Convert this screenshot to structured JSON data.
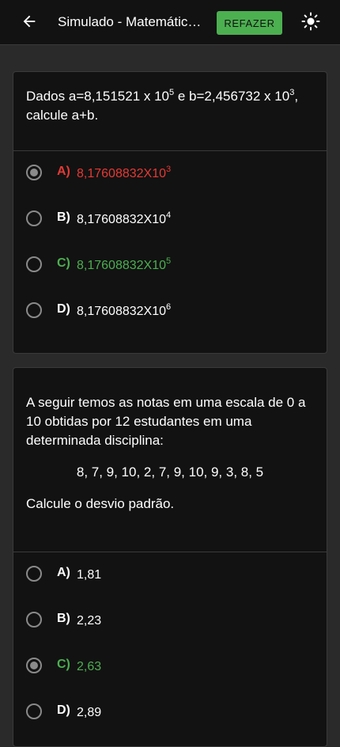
{
  "header": {
    "title": "Simulado - Matemática - Estatística",
    "redo_label": "REFAZER",
    "back_icon": "arrow-left-icon",
    "theme_icon": "sun-icon"
  },
  "colors": {
    "wrong": "#e53935",
    "correct": "#4caf50",
    "accent_button": "#4caf50"
  },
  "questions": [
    {
      "text_a_prefix": "Dados a=8,151521 x 10",
      "text_a_exp": "5",
      "text_b_prefix": " e b=2,456732 x 10",
      "text_b_exp": "3",
      "text_suffix": ",",
      "text_line2": "calcule a+b.",
      "options": [
        {
          "letter": "A)",
          "base": "8,17608832X10",
          "exp": "3",
          "state": "wrong",
          "selected": true
        },
        {
          "letter": "B)",
          "base": "8,17608832X10",
          "exp": "4",
          "state": "neutral",
          "selected": false
        },
        {
          "letter": "C)",
          "base": "8,17608832X10",
          "exp": "5",
          "state": "correct",
          "selected": false
        },
        {
          "letter": "D)",
          "base": "8,17608832X10",
          "exp": "6",
          "state": "neutral",
          "selected": false
        }
      ]
    },
    {
      "text": "A seguir temos as notas em uma escala de 0 a 10 obtidas por 12 estudantes em uma determinada disciplina:",
      "data_line": "8, 7, 9, 10, 2, 7, 9, 10, 9, 3, 8, 5",
      "prompt": "Calcule o desvio padrão.",
      "options": [
        {
          "letter": "A)",
          "value": "1,81",
          "state": "neutral",
          "selected": false
        },
        {
          "letter": "B)",
          "value": "2,23",
          "state": "neutral",
          "selected": false
        },
        {
          "letter": "C)",
          "value": "2,63",
          "state": "correct",
          "selected": true
        },
        {
          "letter": "D)",
          "value": "2,89",
          "state": "neutral",
          "selected": false
        }
      ]
    }
  ]
}
